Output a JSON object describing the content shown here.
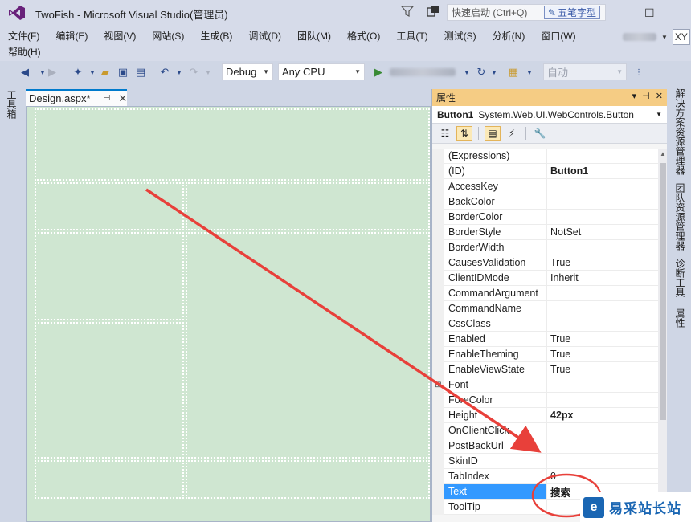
{
  "window": {
    "title": "TwoFish - Microsoft Visual Studio(管理员)",
    "quick_launch_placeholder": "快速启动 (Ctrl+Q)",
    "ime_label": "五笔字型",
    "user_initials": "XY"
  },
  "menu": {
    "row1": [
      "文件(F)",
      "编辑(E)",
      "视图(V)",
      "网站(S)",
      "生成(B)",
      "调试(D)",
      "团队(M)",
      "格式(O)",
      "工具(T)",
      "测试(S)",
      "分析(N)",
      "窗口(W)"
    ],
    "row2": [
      "帮助(H)"
    ]
  },
  "toolbar": {
    "configuration": "Debug",
    "platform": "Any CPU",
    "target": "自动"
  },
  "left_strip": {
    "toolbox_label": "工具箱"
  },
  "editor": {
    "tab_title": "Design.aspx*"
  },
  "properties": {
    "panel_title": "属性",
    "object_name": "Button1",
    "object_type": "System.Web.UI.WebControls.Button",
    "rows": [
      {
        "name": "(Expressions)",
        "value": "",
        "bold": false
      },
      {
        "name": "(ID)",
        "value": "Button1",
        "bold": true
      },
      {
        "name": "AccessKey",
        "value": "",
        "bold": false
      },
      {
        "name": "BackColor",
        "value": "",
        "bold": false
      },
      {
        "name": "BorderColor",
        "value": "",
        "bold": false
      },
      {
        "name": "BorderStyle",
        "value": "NotSet",
        "bold": false
      },
      {
        "name": "BorderWidth",
        "value": "",
        "bold": false
      },
      {
        "name": "CausesValidation",
        "value": "True",
        "bold": false
      },
      {
        "name": "ClientIDMode",
        "value": "Inherit",
        "bold": false
      },
      {
        "name": "CommandArgument",
        "value": "",
        "bold": false
      },
      {
        "name": "CommandName",
        "value": "",
        "bold": false
      },
      {
        "name": "CssClass",
        "value": "",
        "bold": false
      },
      {
        "name": "Enabled",
        "value": "True",
        "bold": false
      },
      {
        "name": "EnableTheming",
        "value": "True",
        "bold": false
      },
      {
        "name": "EnableViewState",
        "value": "True",
        "bold": false
      },
      {
        "name": "Font",
        "value": "",
        "bold": false,
        "expandable": true
      },
      {
        "name": "ForeColor",
        "value": "",
        "bold": false
      },
      {
        "name": "Height",
        "value": "42px",
        "bold": true
      },
      {
        "name": "OnClientClick",
        "value": "",
        "bold": false
      },
      {
        "name": "PostBackUrl",
        "value": "",
        "bold": false
      },
      {
        "name": "SkinID",
        "value": "",
        "bold": false
      },
      {
        "name": "TabIndex",
        "value": "0",
        "bold": false
      },
      {
        "name": "Text",
        "value": "搜索",
        "bold": true,
        "selected": true
      },
      {
        "name": "ToolTip",
        "value": "",
        "bold": false
      }
    ]
  },
  "right_strip": {
    "tabs": [
      "解决方案资源管理器",
      "团队资源管理器",
      "诊断工具",
      "属性"
    ]
  },
  "watermark": {
    "text": "易采站长站"
  },
  "colors": {
    "accent": "#007acc",
    "panel_header": "#f5cc84",
    "design_surface": "#cfe6d1",
    "selection": "#3399ff",
    "annotation": "#e8403a"
  }
}
